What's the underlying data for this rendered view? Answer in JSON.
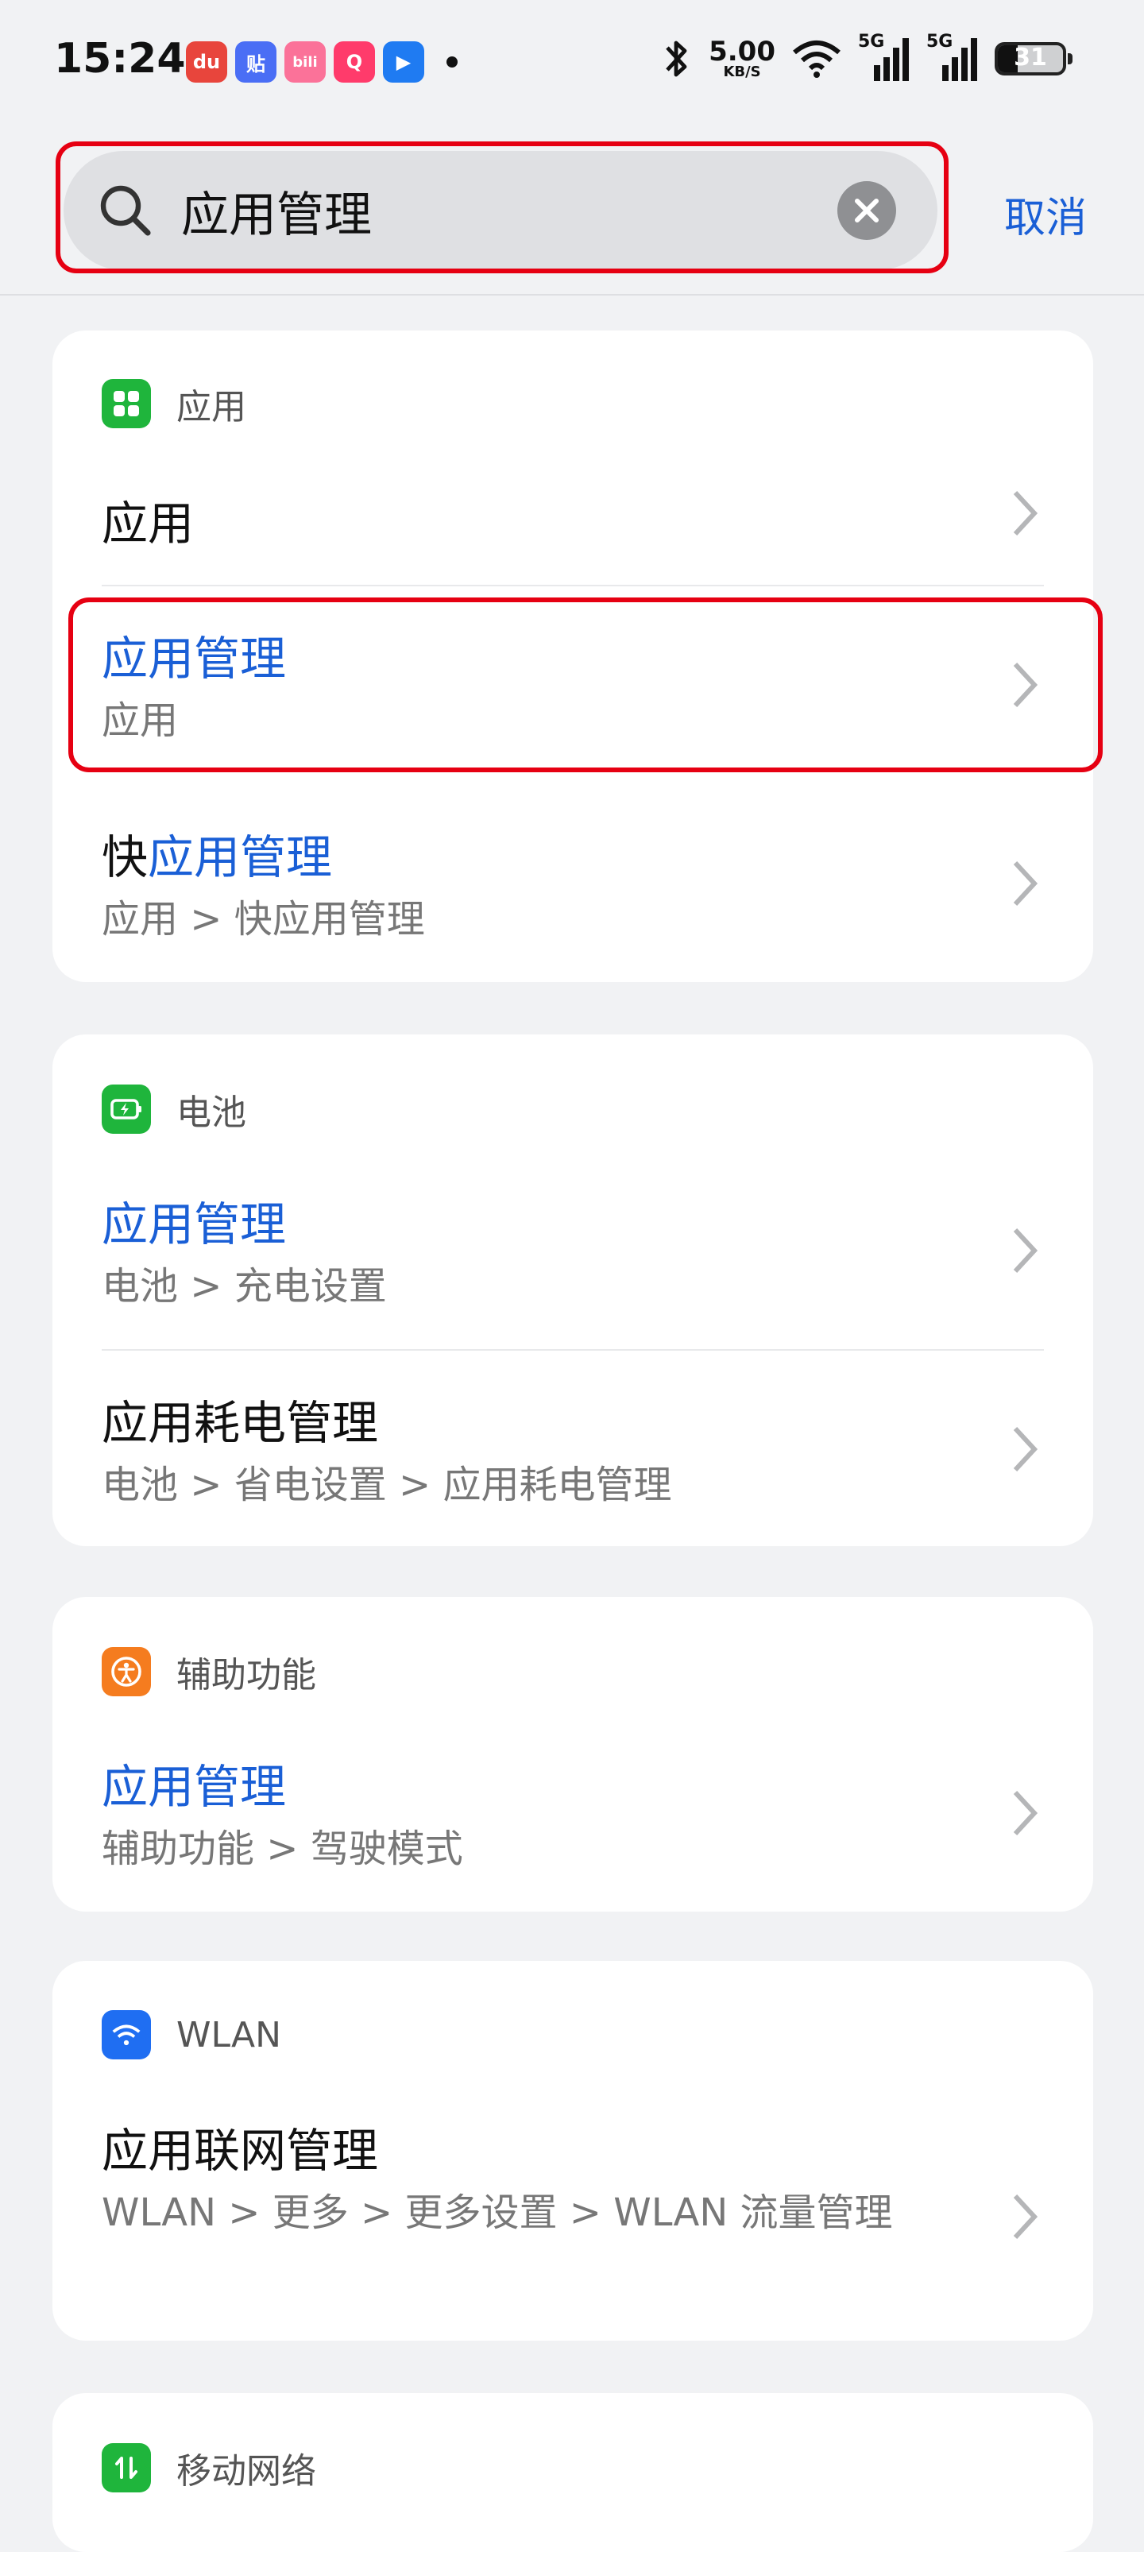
{
  "status": {
    "time": "15:24",
    "notif_icons": [
      {
        "label": "du",
        "color": "#e8453c"
      },
      {
        "label": "贴",
        "color": "#4a6ef5"
      },
      {
        "label": "bili",
        "color": "#fb7299"
      },
      {
        "label": "Q",
        "color": "#ff3b6b"
      },
      {
        "label": "▶",
        "color": "#1f7bf2"
      }
    ],
    "speed_value": "5.00",
    "speed_unit": "KB/S",
    "signal1": "5G",
    "signal2": "5G",
    "battery_level": "31",
    "battery_fraction": 0.31
  },
  "search": {
    "query": "应用管理",
    "cancel_label": "取消"
  },
  "sections": [
    {
      "category": "应用",
      "icon": "apps-icon",
      "icon_color": "#1fb53c",
      "items": [
        {
          "title_plain": "应用",
          "title_hl": "",
          "title_rest": "",
          "subtitle": ""
        },
        {
          "title_plain": "",
          "title_hl": "应用管理",
          "title_rest": "",
          "subtitle": "应用"
        },
        {
          "title_plain": "快",
          "title_hl": "应用管理",
          "title_rest": "",
          "subtitle": "应用 > 快应用管理"
        }
      ]
    },
    {
      "category": "电池",
      "icon": "battery-icon",
      "icon_color": "#1fb53c",
      "items": [
        {
          "title_plain": "",
          "title_hl": "应用管理",
          "title_rest": "",
          "subtitle": "电池 > 充电设置"
        },
        {
          "title_plain": "应用耗电管理",
          "title_hl": "",
          "title_rest": "",
          "subtitle": "电池 > 省电设置 > 应用耗电管理"
        }
      ]
    },
    {
      "category": "辅助功能",
      "icon": "accessibility-icon",
      "icon_color": "#f57c1f",
      "items": [
        {
          "title_plain": "",
          "title_hl": "应用管理",
          "title_rest": "",
          "subtitle": "辅助功能 > 驾驶模式"
        }
      ]
    },
    {
      "category": "WLAN",
      "icon": "wifi-icon",
      "icon_color": "#1f6ef2",
      "items": [
        {
          "title_plain": "应用联网管理",
          "title_hl": "",
          "title_rest": "",
          "subtitle": "WLAN > 更多 > 更多设置 > WLAN 流量管理"
        }
      ]
    },
    {
      "category": "移动网络",
      "icon": "mobile-data-icon",
      "icon_color": "#1fb53c",
      "items": []
    }
  ]
}
